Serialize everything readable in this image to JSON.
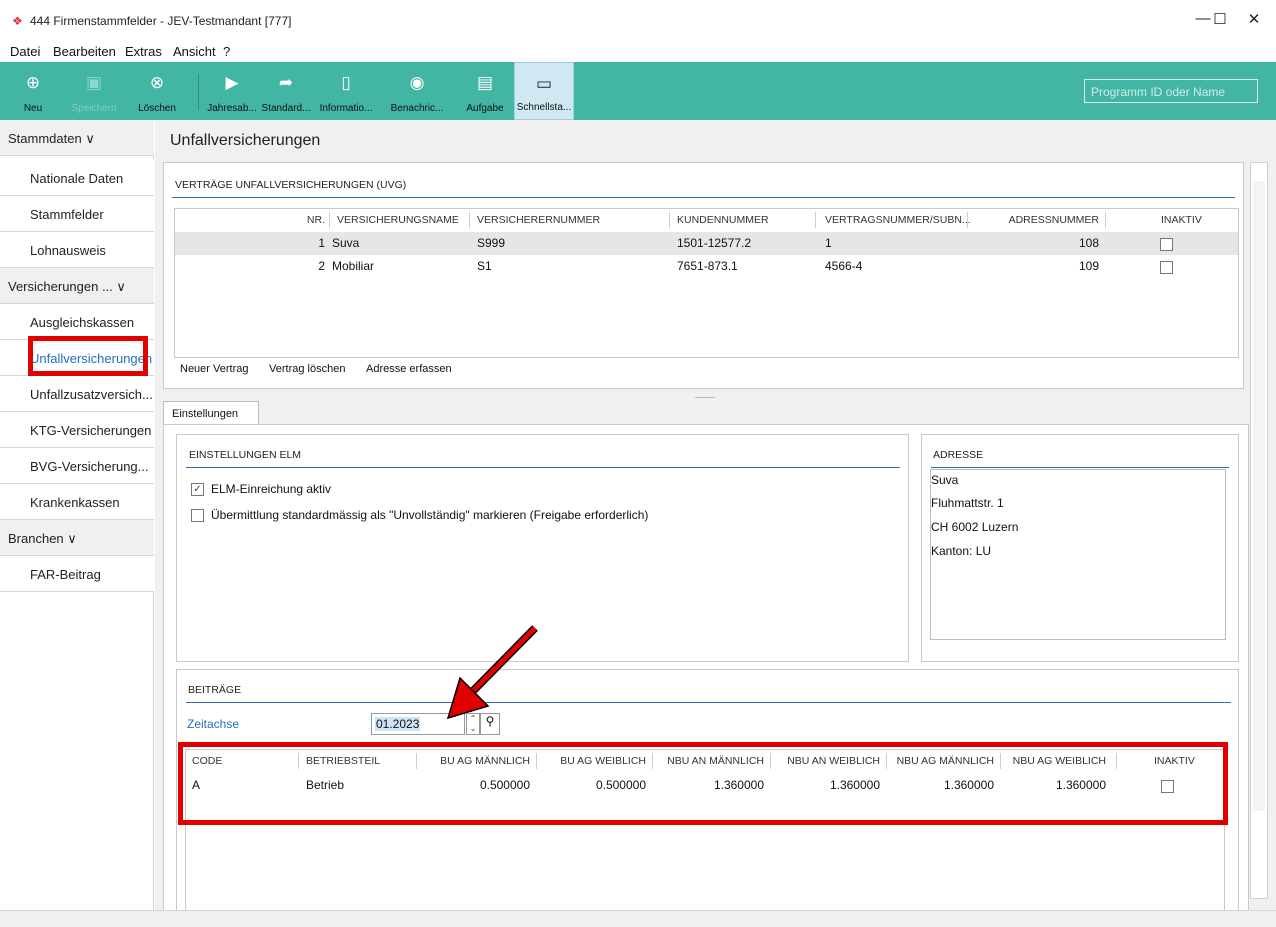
{
  "window": {
    "title": "444 Firmenstammfelder - JEV-Testmandant [777]",
    "minimize": "—",
    "maximize": "☐",
    "close": "✕"
  },
  "menu": [
    "Datei",
    "Bearbeiten",
    "Extras",
    "Ansicht",
    "?"
  ],
  "toolbar": {
    "buttons": [
      {
        "label": "Neu",
        "icon": "new-icon",
        "glyph": "⊕"
      },
      {
        "label": "Speichern",
        "icon": "save-icon",
        "glyph": "▣"
      },
      {
        "label": "Löschen",
        "icon": "delete-icon",
        "glyph": "⊗"
      },
      {
        "label": "Jahresab...",
        "icon": "play-icon",
        "glyph": "▶"
      },
      {
        "label": "Standard...",
        "icon": "share-arrow-icon",
        "glyph": "➦"
      },
      {
        "label": "Informatio...",
        "icon": "document-icon",
        "glyph": "▯"
      },
      {
        "label": "Benachric...",
        "icon": "notification-icon",
        "glyph": "◉"
      },
      {
        "label": "Aufgabe",
        "icon": "task-icon",
        "glyph": "▤"
      },
      {
        "label": "Schnellsta...",
        "icon": "quickstart-icon",
        "glyph": "▭"
      }
    ],
    "search_placeholder": "Programm ID oder Name"
  },
  "sidebar": {
    "groups": [
      {
        "label": "Stammdaten",
        "chevron": "∨"
      },
      {
        "label": "Versicherungen ...",
        "chevron": "∨"
      },
      {
        "label": "Branchen",
        "chevron": "∨"
      }
    ],
    "items": [
      "Nationale Daten",
      "Stammfelder",
      "Lohnausweis",
      "Ausgleichskassen",
      "Unfallversicherungen",
      "Unfallzusatzversich...",
      "KTG-Versicherungen",
      "BVG-Versicherung...",
      "Krankenkassen",
      "FAR-Beitrag"
    ]
  },
  "page": {
    "title": "Unfallversicherungen"
  },
  "contracts": {
    "title": "VERTRÄGE UNFALLVERSICHERUNGEN (UVG)",
    "columns": [
      "NR.",
      "VERSICHERUNGSNAME",
      "VERSICHERERNUMMER",
      "KUNDENNUMMER",
      "VERTRAGSNUMMER/SUBN...",
      "ADRESSNUMMER",
      "INAKTIV"
    ],
    "rows": [
      [
        "1",
        "Suva",
        "S999",
        "1501-12577.2",
        "1",
        "108"
      ],
      [
        "2",
        "Mobiliar",
        "S1",
        "7651-873.1",
        "4566-4",
        "109"
      ]
    ],
    "actions": [
      "Neuer Vertrag",
      "Vertrag löschen",
      "Adresse erfassen"
    ]
  },
  "tab": {
    "label": "Einstellungen"
  },
  "elm": {
    "title": "EINSTELLUNGEN ELM",
    "check1": "ELM-Einreichung aktiv",
    "check1_mark": "✓",
    "check2": "Übermittlung standardmässig als \"Unvollständig\" markieren (Freigabe erforderlich)"
  },
  "address": {
    "title": "ADRESSE",
    "lines": [
      "Suva",
      "Fluhmattstr. 1",
      "CH 6002 Luzern",
      "Kanton: LU"
    ]
  },
  "contributions": {
    "title": "BEITRÄGE",
    "zeitachse_label": "Zeitachse",
    "zeitachse_value": "01.2023",
    "spin_up": "⌃",
    "spin_down": "⌄",
    "search_glyph": "⚲",
    "columns": [
      "CODE",
      "BETRIEBSTEIL",
      "BU AG MÄNNLICH",
      "BU AG WEIBLICH",
      "NBU AN MÄNNLICH",
      "NBU AN WEIBLICH",
      "NBU AG MÄNNLICH",
      "NBU AG WEIBLICH",
      "INAKTIV"
    ],
    "rows": [
      [
        "A",
        "Betrieb",
        "0.500000",
        "0.500000",
        "1.360000",
        "1.360000",
        "1.360000",
        "1.360000"
      ]
    ]
  },
  "colors": {
    "toolbar": "#43b5a3",
    "accent": "#1f6fbe",
    "highlight": "#e00000",
    "selected_row": "#e6e6e6"
  }
}
